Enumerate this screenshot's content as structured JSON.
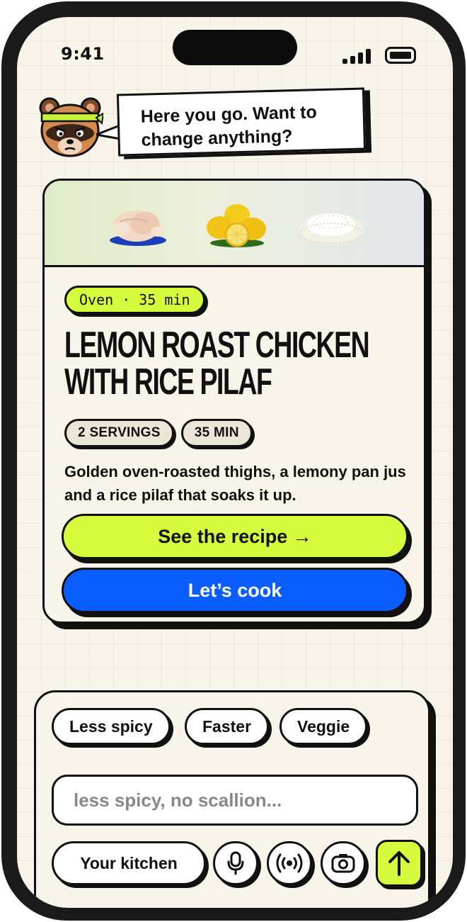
{
  "status_bar": {
    "time": "9:41"
  },
  "assistant": {
    "message": "Here you go. Want to change anything?"
  },
  "recipe": {
    "badge": "Oven · 35 min",
    "title": "Lemon Roast Chicken with Rice Pilaf",
    "chips": [
      "2 SERVINGS",
      "35 MIN"
    ],
    "description": "Golden oven-roasted thighs, a lemony pan jus and a rice pilaf that soaks it up.",
    "primary_button": "See the recipe →",
    "secondary_button": "Let’s cook",
    "hero_items": [
      "raw-chicken",
      "lemons",
      "rice"
    ]
  },
  "composer": {
    "quick_options": [
      "Less spicy",
      "Faster",
      "Veggie"
    ],
    "input_placeholder": "less spicy, no scallion...",
    "kitchen_button": "Your kitchen",
    "icons": [
      "microphone-icon",
      "broadcast-icon",
      "camera-icon",
      "arrow-up-icon"
    ]
  },
  "colors": {
    "background": "#f8f4e9",
    "accent_lime": "#d5fb3c",
    "accent_blue": "#0a5dff",
    "ink": "#111111"
  }
}
